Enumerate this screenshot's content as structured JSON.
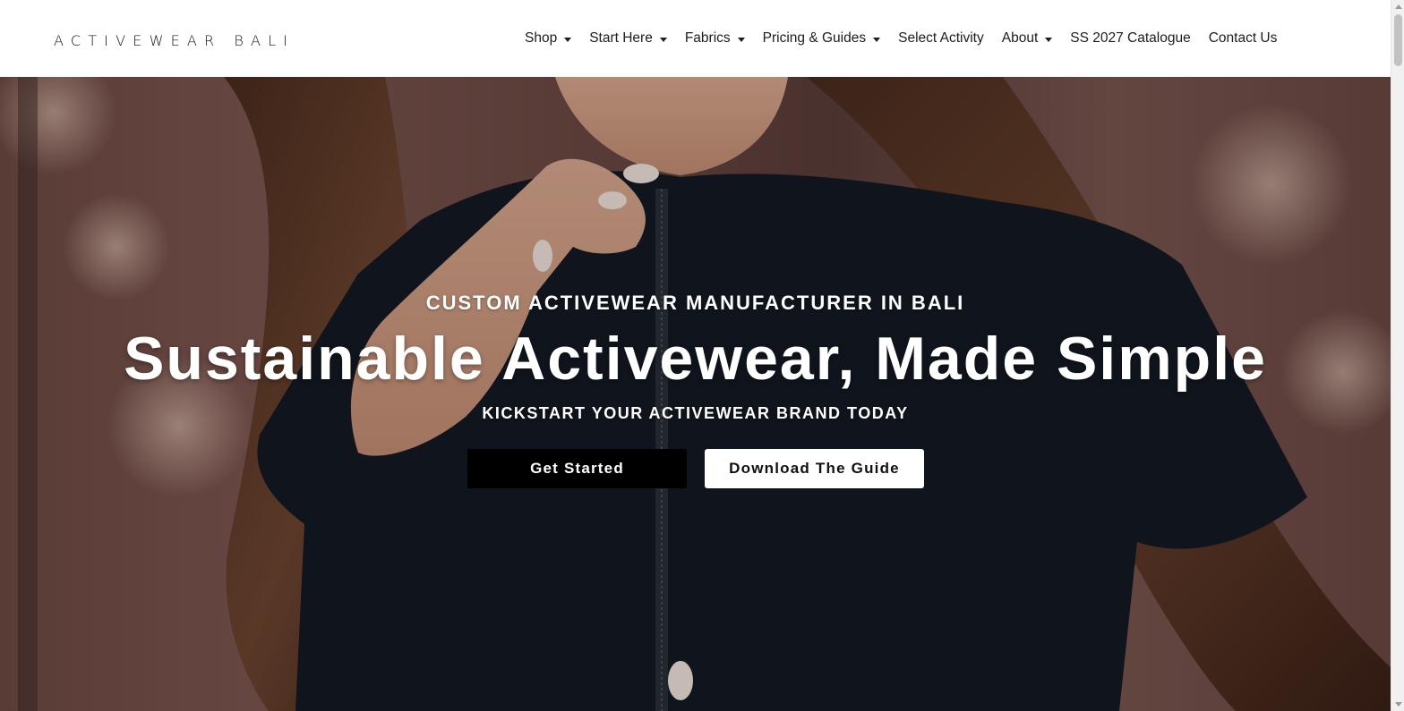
{
  "header": {
    "logo_left": "ACTIVEWEAR",
    "logo_right": "BALI"
  },
  "nav": {
    "items": [
      {
        "label": "Shop",
        "has_dropdown": true
      },
      {
        "label": "Start Here",
        "has_dropdown": true
      },
      {
        "label": "Fabrics",
        "has_dropdown": true
      },
      {
        "label": "Pricing & Guides",
        "has_dropdown": true
      },
      {
        "label": "Select Activity",
        "has_dropdown": false
      },
      {
        "label": "About",
        "has_dropdown": true
      },
      {
        "label": "SS 2027 Catalogue",
        "has_dropdown": false
      },
      {
        "label": "Contact Us",
        "has_dropdown": false
      }
    ]
  },
  "hero": {
    "eyebrow": "CUSTOM ACTIVEWEAR MANUFACTURER IN BALI",
    "headline": "Sustainable Activewear, Made Simple",
    "subline": "KICKSTART YOUR ACTIVEWEAR BRAND TODAY",
    "primary_cta": "Get Started",
    "secondary_cta": "Download The Guide"
  },
  "colors": {
    "primary_button_bg": "#000000",
    "secondary_button_bg": "#ffffff",
    "hero_text": "#ffffff"
  }
}
